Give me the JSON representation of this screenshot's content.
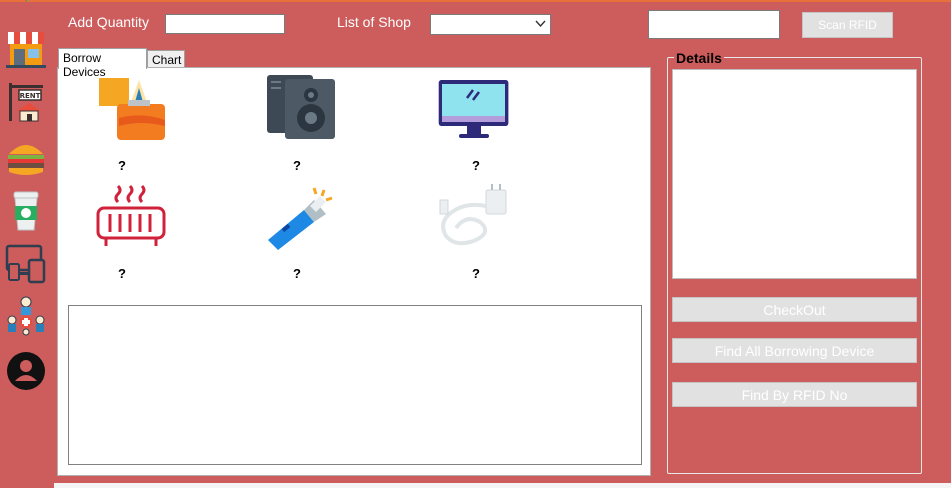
{
  "sidebar": {
    "items": [
      {
        "name": "shop-icon"
      },
      {
        "name": "rent-icon"
      },
      {
        "name": "burger-icon"
      },
      {
        "name": "coffee-cup-icon"
      },
      {
        "name": "devices-icon"
      },
      {
        "name": "people-icon"
      },
      {
        "name": "user-icon"
      }
    ]
  },
  "toolbar": {
    "add_quantity_label": "Add Quantity",
    "add_quantity_value": "",
    "list_of_shop_label": "List of Shop",
    "shop_selected": "",
    "rfid_value": "",
    "scan_rfid_label": "Scan RFID"
  },
  "tabs": [
    {
      "label": "Borrow Devices",
      "active": true
    },
    {
      "label": "Chart",
      "active": false
    }
  ],
  "devices": [
    {
      "icon": "lighter-icon",
      "quantity": "?"
    },
    {
      "icon": "speaker-icon",
      "quantity": "?"
    },
    {
      "icon": "monitor-icon",
      "quantity": "?"
    },
    {
      "icon": "heater-icon",
      "quantity": "?"
    },
    {
      "icon": "flashlight-icon",
      "quantity": "?"
    },
    {
      "icon": "charger-icon",
      "quantity": "?"
    }
  ],
  "details": {
    "title": "Details",
    "content": "",
    "checkout_label": "CheckOut",
    "find_all_label": "Find All Borrowing Device",
    "find_rfid_label": "Find By RFID No"
  },
  "colors": {
    "background": "#cd5c5c",
    "button_face": "#e1e1e1",
    "panel": "#ffffff"
  }
}
